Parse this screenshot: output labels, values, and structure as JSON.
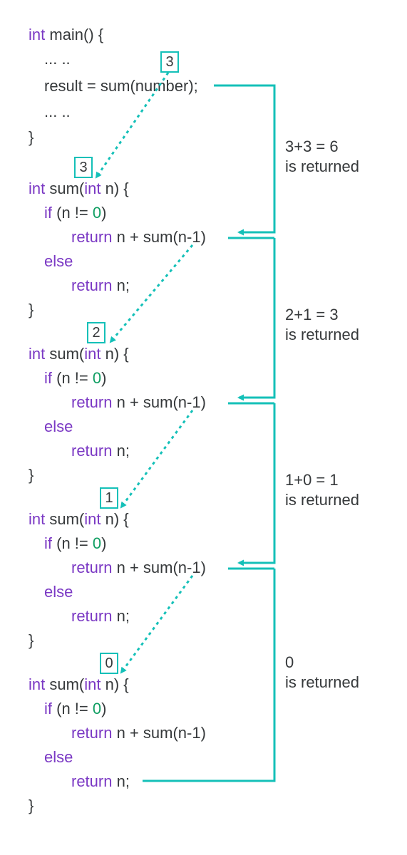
{
  "main": {
    "sig_kw": "int",
    "sig_rest": " main() {",
    "dots1": "... ..",
    "call_lhs": "result = ",
    "call_fn": "sum",
    "call_arg": "(number);",
    "dots2": "... ..",
    "close": "}"
  },
  "boxes": {
    "top": "3",
    "b3": "3",
    "b2": "2",
    "b1": "1",
    "b0": "0"
  },
  "fn": {
    "sig_kw": "int",
    "sig_name": " sum(",
    "sig_param_kw": "int",
    "sig_param": " n) {",
    "if_kw": "if",
    "if_cond_a": " (n != ",
    "zero": "0",
    "if_cond_b": ")",
    "ret1_kw": "return",
    "ret1_body": " n + sum(n-1)",
    "else_kw": "else",
    "ret2_kw": "return",
    "ret2_body": " n;",
    "close": "}"
  },
  "returns": {
    "r3a": "3+3 = 6",
    "r3b": "is returned",
    "r2a": "2+1 = 3",
    "r2b": "is returned",
    "r1a": "1+0 = 1",
    "r1b": "is returned",
    "r0a": "0",
    "r0b": "is returned"
  },
  "colors": {
    "teal": "#14c0b8"
  }
}
